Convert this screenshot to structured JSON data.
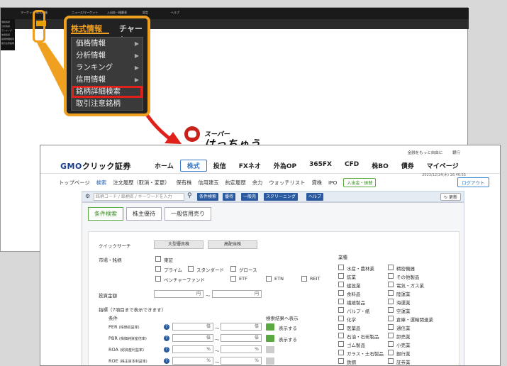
{
  "background_app": {
    "menubar": [
      "マーケット",
      "株式情報",
      "ニュース/マーケット",
      "入出金・精算表",
      "設定",
      "ウインドウ",
      "ヘルプ"
    ],
    "sidebar": [
      "価格情報",
      "分析情報",
      "ランキング",
      "信用情報",
      "銘柄詳細検索",
      "取引注意銘柄"
    ]
  },
  "menu": {
    "active_tab": "株式情報",
    "other_tab": "チャート",
    "items": [
      {
        "label": "価格情報",
        "has_submenu": true
      },
      {
        "label": "分析情報",
        "has_submenu": true
      },
      {
        "label": "ランキング",
        "has_submenu": true
      },
      {
        "label": "信用情報",
        "has_submenu": true
      },
      {
        "label": "銘柄詳細検索",
        "has_submenu": false,
        "highlighted": true
      },
      {
        "label": "取引注意銘柄",
        "has_submenu": false
      }
    ]
  },
  "mascot": {
    "small": "スーパー",
    "big": "はっちゅう君"
  },
  "site": {
    "top_links": [
      "金融をもっと自由に",
      "銀行"
    ],
    "brand_main": "GMO",
    "brand_sub": "クリック証券",
    "global_nav": [
      "ホーム",
      "株式",
      "投信",
      "FXネオ",
      "外為OP",
      "365FX",
      "CFD",
      "株BO",
      "債券",
      "マイページ"
    ],
    "global_nav_active": 1,
    "datetime": "2023/12/14(木) 16:46:55",
    "sub_nav": [
      "トップページ",
      "検索",
      "注文履歴（取消・変更）",
      "保有株",
      "信用建玉",
      "約定履歴",
      "余力",
      "ウォッチリスト",
      "貸株",
      "IPO"
    ],
    "sub_nav_active": 1,
    "deposit_pill": "入出金・振替",
    "logout": "ログアウト"
  },
  "searchbar": {
    "placeholder": "銘柄コード / 銘柄名 / キーワードを入力",
    "buttons": [
      "条件検索",
      "優待",
      "一般売",
      "スクリーニング",
      "ヘルプ"
    ],
    "refresh": "更新"
  },
  "panel": {
    "tabs": [
      "条件検索",
      "株主優待",
      "一般信用売り"
    ],
    "active_tab": 0,
    "quick_search": "クイックサーチ",
    "quick_buttons": [
      "大型優良株",
      "高配当株"
    ],
    "market_label": "市場・銘柄",
    "markets": [
      "東証",
      "プライム",
      "スタンダード",
      "グロース",
      "ベンチャーファンド",
      "ETF",
      "ETN",
      "REIT"
    ],
    "amount_label": "投資金額",
    "amount_unit": "円",
    "range_sep": "〜",
    "indicator_label": "指標（7項目まで表示できます）",
    "cond_label": "条件",
    "show_label": "検索結果へ表示",
    "show_text": "表示する",
    "indicators": [
      {
        "name": "PER",
        "note": "(株価収益率)",
        "unit": "倍",
        "shown": true
      },
      {
        "name": "PBR",
        "note": "(株価純資産倍率)",
        "unit": "倍",
        "shown": true
      },
      {
        "name": "ROA",
        "note": "(総資産利益率)",
        "unit": "%",
        "shown": false
      },
      {
        "name": "ROE",
        "note": "(株主資本利益率)",
        "unit": "%",
        "shown": false
      }
    ],
    "industry_label": "業種",
    "industries_col1": [
      "水産・農林業",
      "鉱業",
      "建設業",
      "食料品",
      "繊維製品",
      "パルプ・紙",
      "化学",
      "医薬品",
      "石油・石炭製品",
      "ゴム製品",
      "ガラス・土石製品",
      "鉄鋼"
    ],
    "industries_col2": [
      "精密機器",
      "その他製品",
      "電気・ガス業",
      "陸運業",
      "海運業",
      "空運業",
      "倉庫・運輸関連業",
      "通信業",
      "卸売業",
      "小売業",
      "銀行業",
      "証券業"
    ]
  },
  "colors": {
    "highlight": "#f0a020",
    "selected_border": "#e0201a",
    "brand": "#1a3d8f"
  }
}
